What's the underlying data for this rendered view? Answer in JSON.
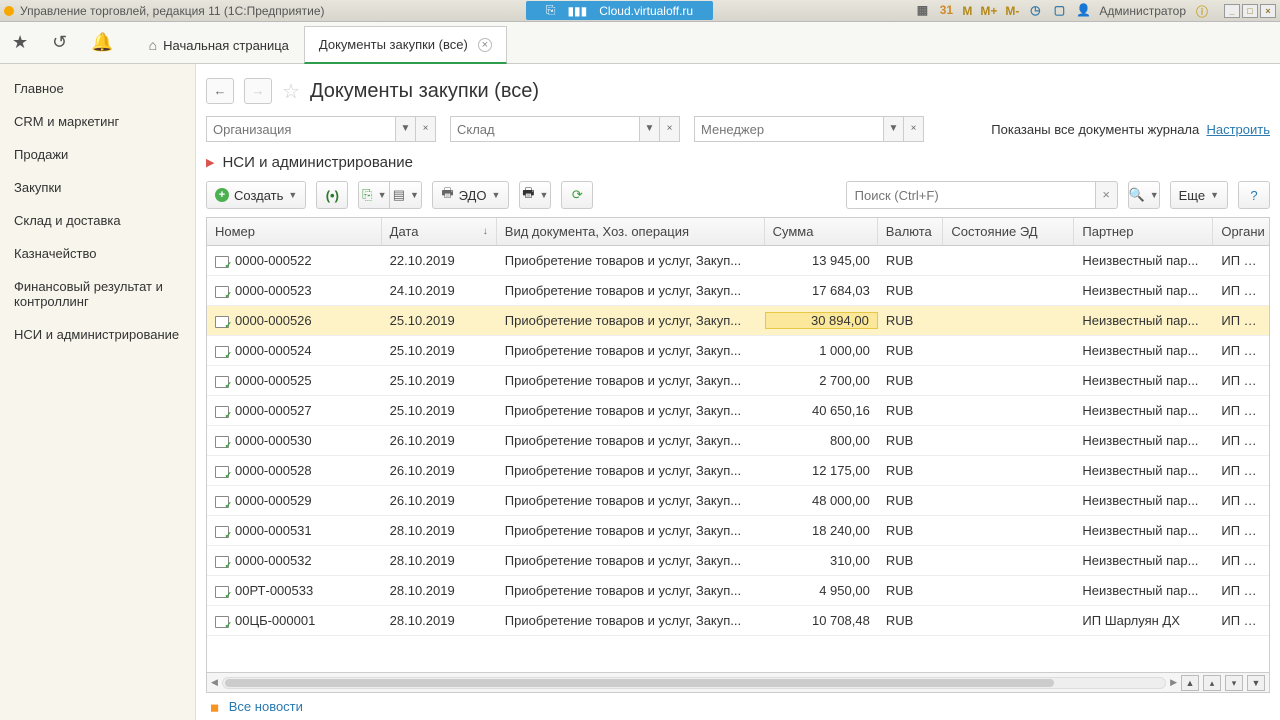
{
  "titlebar": {
    "app_title": "Управление торговлей, редакция 11 (1С:Предприятие)",
    "cloud": "Cloud.virtualoff.ru",
    "m_buttons": [
      "М",
      "М+",
      "М-"
    ],
    "user": "Администратор"
  },
  "tabs": {
    "home": "Начальная страница",
    "active": "Документы закупки (все)"
  },
  "sidebar": {
    "items": [
      "Главное",
      "CRM и маркетинг",
      "Продажи",
      "Закупки",
      "Склад и доставка",
      "Казначейство",
      "Финансовый результат и контроллинг",
      "НСИ и администрирование"
    ]
  },
  "page": {
    "title": "Документы закупки (все)",
    "nsi": "НСИ и администрирование"
  },
  "filters": {
    "org_placeholder": "Организация",
    "wh_placeholder": "Склад",
    "mgr_placeholder": "Менеджер",
    "note_text": "Показаны все документы журнала",
    "link": "Настроить"
  },
  "toolbar": {
    "create": "Создать",
    "edo": "ЭДО",
    "search_placeholder": "Поиск (Ctrl+F)",
    "more": "Еще"
  },
  "columns": {
    "number": "Номер",
    "date": "Дата",
    "type": "Вид документа, Хоз. операция",
    "sum": "Сумма",
    "currency": "Валюта",
    "state": "Состояние ЭД",
    "partner": "Партнер",
    "org": "Органи"
  },
  "rows": [
    {
      "num": "0000-000522",
      "date": "22.10.2019",
      "type": "Приобретение товаров и услуг, Закуп...",
      "sum": "13 945,00",
      "cur": "RUB",
      "partner": "Неизвестный пар...",
      "org": "ИП Дег"
    },
    {
      "num": "0000-000523",
      "date": "24.10.2019",
      "type": "Приобретение товаров и услуг, Закуп...",
      "sum": "17 684,03",
      "cur": "RUB",
      "partner": "Неизвестный пар...",
      "org": "ИП Дег"
    },
    {
      "num": "0000-000526",
      "date": "25.10.2019",
      "type": "Приобретение товаров и услуг, Закуп...",
      "sum": "30 894,00",
      "cur": "RUB",
      "partner": "Неизвестный пар...",
      "org": "ИП Дег",
      "sel": true
    },
    {
      "num": "0000-000524",
      "date": "25.10.2019",
      "type": "Приобретение товаров и услуг, Закуп...",
      "sum": "1 000,00",
      "cur": "RUB",
      "partner": "Неизвестный пар...",
      "org": "ИП Дег"
    },
    {
      "num": "0000-000525",
      "date": "25.10.2019",
      "type": "Приобретение товаров и услуг, Закуп...",
      "sum": "2 700,00",
      "cur": "RUB",
      "partner": "Неизвестный пар...",
      "org": "ИП Дег"
    },
    {
      "num": "0000-000527",
      "date": "25.10.2019",
      "type": "Приобретение товаров и услуг, Закуп...",
      "sum": "40 650,16",
      "cur": "RUB",
      "partner": "Неизвестный пар...",
      "org": "ИП Дег"
    },
    {
      "num": "0000-000530",
      "date": "26.10.2019",
      "type": "Приобретение товаров и услуг, Закуп...",
      "sum": "800,00",
      "cur": "RUB",
      "partner": "Неизвестный пар...",
      "org": "ИП Дег"
    },
    {
      "num": "0000-000528",
      "date": "26.10.2019",
      "type": "Приобретение товаров и услуг, Закуп...",
      "sum": "12 175,00",
      "cur": "RUB",
      "partner": "Неизвестный пар...",
      "org": "ИП Дег"
    },
    {
      "num": "0000-000529",
      "date": "26.10.2019",
      "type": "Приобретение товаров и услуг, Закуп...",
      "sum": "48 000,00",
      "cur": "RUB",
      "partner": "Неизвестный пар...",
      "org": "ИП Дег"
    },
    {
      "num": "0000-000531",
      "date": "28.10.2019",
      "type": "Приобретение товаров и услуг, Закуп...",
      "sum": "18 240,00",
      "cur": "RUB",
      "partner": "Неизвестный пар...",
      "org": "ИП Дег"
    },
    {
      "num": "0000-000532",
      "date": "28.10.2019",
      "type": "Приобретение товаров и услуг, Закуп...",
      "sum": "310,00",
      "cur": "RUB",
      "partner": "Неизвестный пар...",
      "org": "ИП Дег"
    },
    {
      "num": "00РТ-000533",
      "date": "28.10.2019",
      "type": "Приобретение товаров и услуг, Закуп...",
      "sum": "4 950,00",
      "cur": "RUB",
      "partner": "Неизвестный пар...",
      "org": "ИП Дег"
    },
    {
      "num": "00ЦБ-000001",
      "date": "28.10.2019",
      "type": "Приобретение товаров и услуг, Закуп...",
      "sum": "10 708,48",
      "cur": "RUB",
      "partner": "ИП Шарлуян ДХ",
      "org": "ИП Дег"
    }
  ],
  "footer": {
    "all_news": "Все новости"
  }
}
